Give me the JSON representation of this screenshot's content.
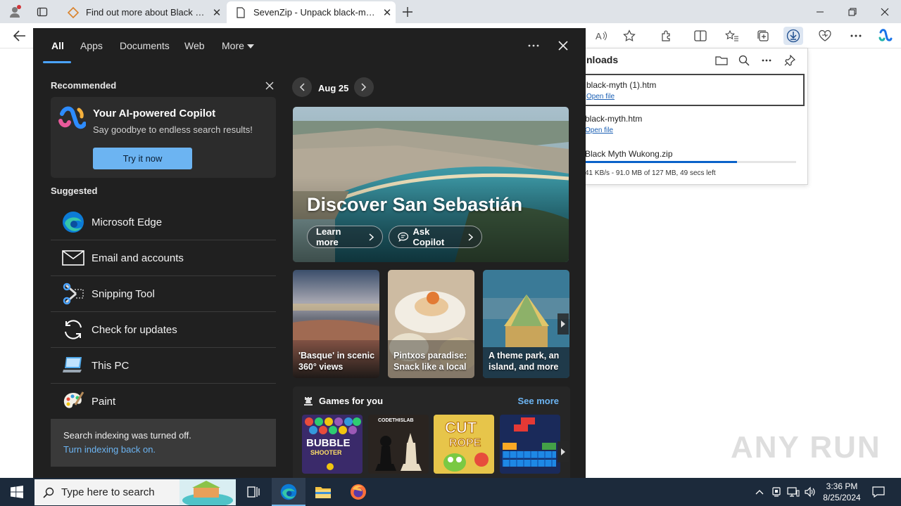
{
  "browser": {
    "tabs": [
      {
        "title": "Find out more about Black Myth: Wukong"
      },
      {
        "title": "SevenZip - Unpack black-myth-wukong"
      }
    ]
  },
  "downloads": {
    "title": "nloads",
    "items": [
      {
        "name": "black-myth (1).htm",
        "action": "Open file"
      },
      {
        "name": "black-myth.htm",
        "action": "Open file"
      },
      {
        "name": "Black Myth Wukong.zip",
        "status": "41 KB/s - 91.0 MB of 127 MB, 49 secs left",
        "progress": 0.72
      }
    ]
  },
  "search_panel": {
    "tabs": [
      "All",
      "Apps",
      "Documents",
      "Web",
      "More"
    ],
    "recommended_title": "Recommended",
    "copilot": {
      "heading": "Your AI-powered Copilot",
      "subtitle": "Say goodbye to endless search results!",
      "button": "Try it now"
    },
    "suggested_title": "Suggested",
    "suggested": [
      {
        "label": "Microsoft Edge",
        "icon": "edge-icon"
      },
      {
        "label": "Email and accounts",
        "icon": "mail-icon"
      },
      {
        "label": "Snipping Tool",
        "icon": "snipping-tool-icon"
      },
      {
        "label": "Check for updates",
        "icon": "refresh-icon"
      },
      {
        "label": "This PC",
        "icon": "computer-icon"
      },
      {
        "label": "Paint",
        "icon": "paint-icon"
      }
    ],
    "indexing": {
      "message": "Search indexing was turned off.",
      "link": "Turn indexing back on."
    },
    "date": "Aug 25",
    "hero": {
      "title": "Discover San Sebastián",
      "learn_more": "Learn more",
      "ask_copilot": "Ask Copilot"
    },
    "cards": [
      {
        "caption": "'Basque' in scenic 360° views"
      },
      {
        "caption": "Pintxos paradise: Snack like a local"
      },
      {
        "caption": "A theme park, an island, and more"
      }
    ],
    "games": {
      "title": "Games for you",
      "see_more": "See more",
      "items": [
        {
          "name": "BUBBLE SHOOTER HD"
        },
        {
          "name": "CODETHISLAB"
        },
        {
          "name": "CUT the ROPE"
        },
        {
          "name": "Block puzzle"
        }
      ]
    }
  },
  "watermark": "ANY RUN",
  "taskbar": {
    "search_placeholder": "Type here to search",
    "time": "3:36 PM",
    "date": "8/25/2024"
  },
  "colors": {
    "accent": "#4aa3ff",
    "copilot_button": "#6cb4f2",
    "panel_bg": "#202020",
    "taskbar_bg": "#1c2a3b"
  }
}
